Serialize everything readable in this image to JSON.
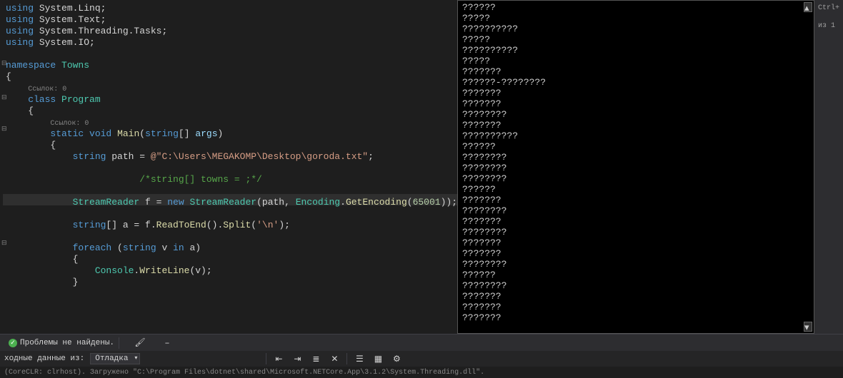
{
  "code": {
    "l1": "using System.Linq;",
    "l2": "using System.Text;",
    "l3": "using System.Threading.Tasks;",
    "l4": "using System.IO;",
    "l5": "namespace Towns",
    "l6": "{",
    "ref1": "Ссылок: 0",
    "l7": "    class Program",
    "l8": "    {",
    "ref2": "Ссылок: 0",
    "l9": "        static void Main(string[] args)",
    "l10": "        {",
    "l11_a": "            string path = ",
    "l11_b": "@\"C:\\Users\\MEGAKOMP\\Desktop\\goroda.txt\"",
    "l11_c": ";",
    "l12": "            /*string[] towns = ;*/",
    "l13_a": "            StreamReader f = ",
    "l13_b": "new",
    "l13_c": " StreamReader(path, Encoding.GetEncoding(",
    "l13_d": "65001",
    "l13_e": "));",
    "l14_a": "            string[] a = f.ReadToEnd().Split(",
    "l14_b": "'\\n'",
    "l14_c": ");",
    "l15": "            foreach (string v in a)",
    "l16": "            {",
    "l17_a": "                Console.WriteLine(v);",
    "l18": "            }"
  },
  "console": {
    "lines": [
      "??????",
      "?????",
      "??????????",
      "?????",
      "??????????",
      "?????",
      "???????",
      "??????-????????",
      "???????",
      "???????",
      "????????",
      "???????",
      "??????????",
      "??????",
      "????????",
      "????????",
      "????????",
      "??????",
      "???????",
      "????????",
      "???????",
      "????????",
      "???????",
      "???????",
      "????????",
      "??????",
      "????????",
      "???????",
      "???????",
      "???????"
    ]
  },
  "status": {
    "problems": "Проблемы не найдены.",
    "output_label": "ходные данные из:",
    "output_source": "Отладка",
    "debug_line": "(CoreCLR: clrhost). Загружено \"C:\\Program Files\\dotnet\\shared\\Microsoft.NETCore.App\\3.1.2\\System.Threading.dll\"."
  },
  "right": {
    "ctrl": "Ctrl+",
    "iz": "из 1"
  }
}
